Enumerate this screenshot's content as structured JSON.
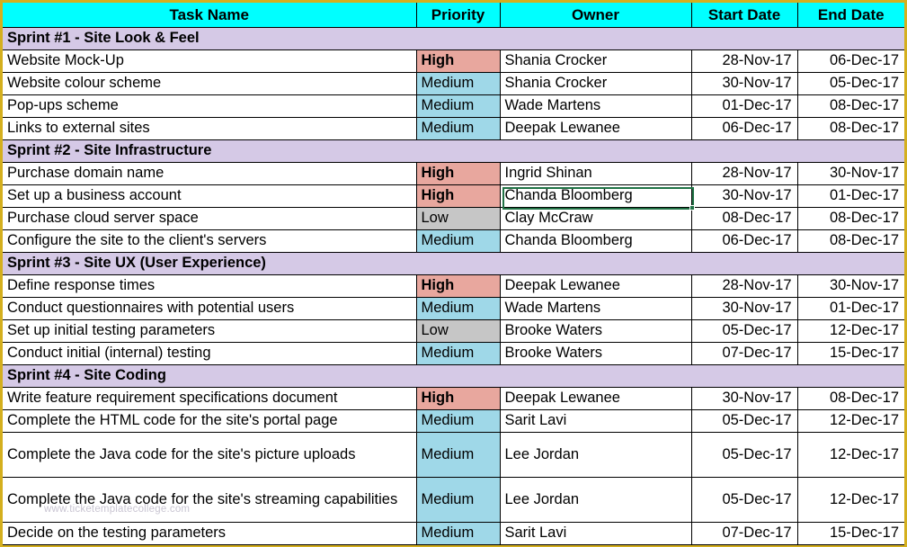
{
  "document": {
    "type": "spreadsheet-task-tracker",
    "watermark": "www.ticketemplatecollege.com"
  },
  "colors": {
    "header_bg": "#00ffff",
    "sprint_bg": "#d5c9e6",
    "priority_high": "#e8a79e",
    "priority_medium": "#9fd8e8",
    "priority_low": "#c6c6c6",
    "sheet_border": "#d4af1e",
    "selection_border": "#217346",
    "cell_bg": "#ffffff",
    "grid_line": "#000000"
  },
  "columns": [
    {
      "key": "task_name",
      "label": "Task Name"
    },
    {
      "key": "priority",
      "label": "Priority"
    },
    {
      "key": "owner",
      "label": "Owner"
    },
    {
      "key": "start_date",
      "label": "Start Date"
    },
    {
      "key": "end_date",
      "label": "End Date"
    }
  ],
  "selection": {
    "cell_text": "Chanda Bloomberg",
    "column": "Owner",
    "row_index": 6
  },
  "sections": [
    {
      "title": "Sprint #1 - Site Look & Feel",
      "rows": [
        {
          "task_name": "Website Mock-Up",
          "priority": "High",
          "owner": "Shania Crocker",
          "start_date": "28-Nov-17",
          "end_date": "06-Dec-17"
        },
        {
          "task_name": "Website colour scheme",
          "priority": "Medium",
          "owner": "Shania Crocker",
          "start_date": "30-Nov-17",
          "end_date": "05-Dec-17"
        },
        {
          "task_name": "Pop-ups scheme",
          "priority": "Medium",
          "owner": "Wade Martens",
          "start_date": "01-Dec-17",
          "end_date": "08-Dec-17"
        },
        {
          "task_name": "Links to external sites",
          "priority": "Medium",
          "owner": "Deepak Lewanee",
          "start_date": "06-Dec-17",
          "end_date": "08-Dec-17"
        }
      ]
    },
    {
      "title": "Sprint #2 - Site Infrastructure",
      "rows": [
        {
          "task_name": "Purchase domain name",
          "priority": "High",
          "owner": "Ingrid Shinan",
          "start_date": "28-Nov-17",
          "end_date": "30-Nov-17"
        },
        {
          "task_name": "Set up a business account",
          "priority": "High",
          "owner": "Chanda Bloomberg",
          "start_date": "30-Nov-17",
          "end_date": "01-Dec-17",
          "selected": true
        },
        {
          "task_name": "Purchase cloud server space",
          "priority": "Low",
          "owner": "Clay McCraw",
          "start_date": "08-Dec-17",
          "end_date": "08-Dec-17"
        },
        {
          "task_name": "Configure the site to the client's servers",
          "priority": "Medium",
          "owner": "Chanda Bloomberg",
          "start_date": "06-Dec-17",
          "end_date": "08-Dec-17"
        }
      ]
    },
    {
      "title": "Sprint #3 - Site UX (User Experience)",
      "rows": [
        {
          "task_name": "Define response times",
          "priority": "High",
          "owner": "Deepak Lewanee",
          "start_date": "28-Nov-17",
          "end_date": "30-Nov-17"
        },
        {
          "task_name": "Conduct questionnaires with potential users",
          "priority": "Medium",
          "owner": "Wade Martens",
          "start_date": "30-Nov-17",
          "end_date": "01-Dec-17"
        },
        {
          "task_name": "Set up initial testing parameters",
          "priority": "Low",
          "owner": "Brooke Waters",
          "start_date": "05-Dec-17",
          "end_date": "12-Dec-17"
        },
        {
          "task_name": "Conduct initial (internal) testing",
          "priority": "Medium",
          "owner": "Brooke Waters",
          "start_date": "07-Dec-17",
          "end_date": "15-Dec-17"
        }
      ]
    },
    {
      "title": "Sprint #4 - Site Coding",
      "rows": [
        {
          "task_name": "Write feature requirement specifications document",
          "priority": "High",
          "owner": "Deepak Lewanee",
          "start_date": "30-Nov-17",
          "end_date": "08-Dec-17"
        },
        {
          "task_name": "Complete the HTML code for the site's portal page",
          "priority": "Medium",
          "owner": "Sarit Lavi",
          "start_date": "05-Dec-17",
          "end_date": "12-Dec-17"
        },
        {
          "task_name": "Complete the Java code for the site's picture uploads",
          "priority": "Medium",
          "owner": "Lee Jordan",
          "start_date": "05-Dec-17",
          "end_date": "12-Dec-17",
          "tall": true
        },
        {
          "task_name": "Complete the Java code for the site's streaming capabilities",
          "priority": "Medium",
          "owner": "Lee Jordan",
          "start_date": "05-Dec-17",
          "end_date": "12-Dec-17",
          "tall": true
        },
        {
          "task_name": "Decide on the testing parameters",
          "priority": "Medium",
          "owner": "Sarit Lavi",
          "start_date": "07-Dec-17",
          "end_date": "15-Dec-17"
        }
      ]
    }
  ]
}
